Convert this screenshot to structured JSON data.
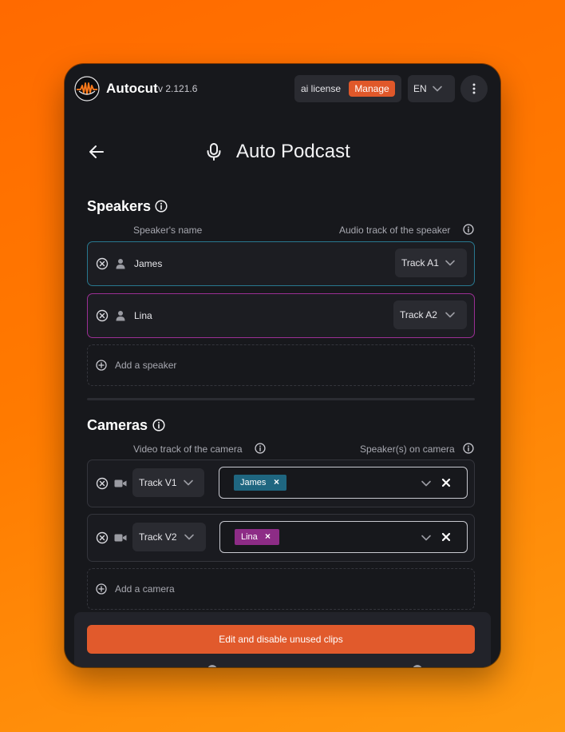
{
  "app": {
    "name": "Autocut",
    "version": "v 2.121.6"
  },
  "license": {
    "label": "ai license",
    "manage_label": "Manage"
  },
  "language": {
    "selected": "EN"
  },
  "page": {
    "title": "Auto Podcast"
  },
  "speakers": {
    "title": "Speakers",
    "name_column": "Speaker's name",
    "track_column": "Audio track of the speaker",
    "items": [
      {
        "name": "James",
        "track": "Track A1",
        "color": "#28788f"
      },
      {
        "name": "Lina",
        "track": "Track A2",
        "color": "#9b2f94"
      }
    ],
    "add_label": "Add a speaker"
  },
  "cameras": {
    "title": "Cameras",
    "video_column": "Video track of the camera",
    "speakers_column": "Speaker(s) on camera",
    "items": [
      {
        "track": "Track V1",
        "speakers": [
          "James"
        ],
        "tag_color": "#1f6680"
      },
      {
        "track": "Track V2",
        "speakers": [
          "Lina"
        ],
        "tag_color": "#8d2c86"
      }
    ],
    "add_label": "Add a camera"
  },
  "footer": {
    "primary_label": "Edit and disable unused clips"
  },
  "colors": {
    "accent": "#e15a2c",
    "background_gradient": [
      "#ff6a00",
      "#ff9a10"
    ],
    "panel": "#17181c"
  }
}
